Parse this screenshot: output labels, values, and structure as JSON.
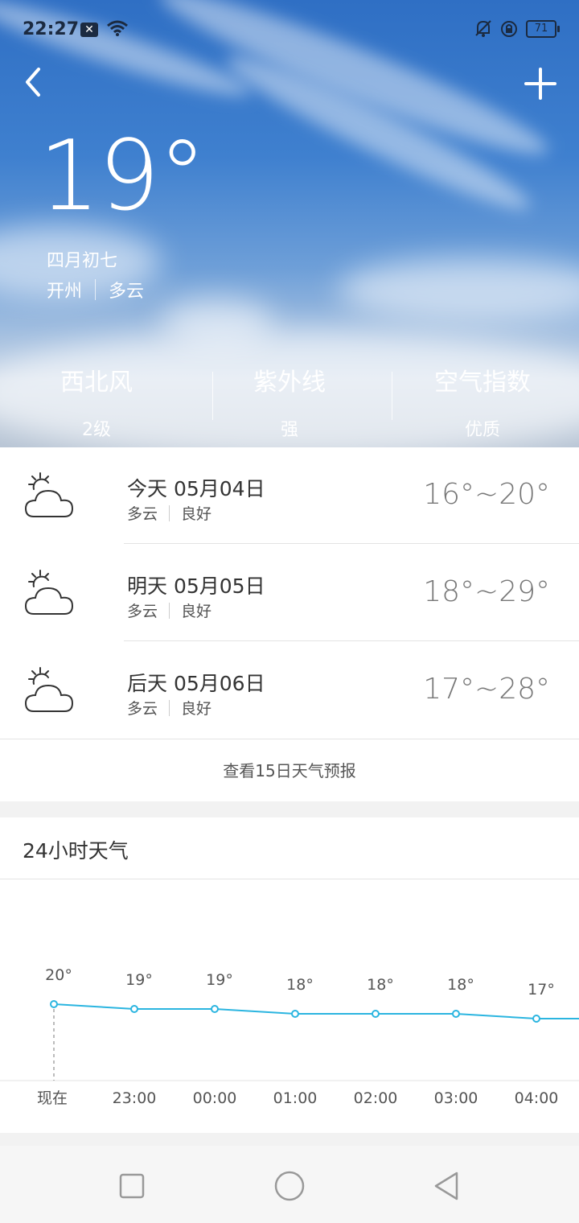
{
  "status_bar": {
    "time": "22:27",
    "battery": "71"
  },
  "current": {
    "temperature": "19°",
    "lunar_date": "四月初七",
    "city": "开州",
    "condition": "多云"
  },
  "metrics": [
    {
      "label": "西北风",
      "value": "2级"
    },
    {
      "label": "紫外线",
      "value": "强"
    },
    {
      "label": "空气指数",
      "value": "优质"
    }
  ],
  "forecast": [
    {
      "date": "今天 05月04日",
      "condition": "多云",
      "air": "良好",
      "range": "16°~20°",
      "icon": "partly-cloudy-icon"
    },
    {
      "date": "明天 05月05日",
      "condition": "多云",
      "air": "良好",
      "range": "18°~29°",
      "icon": "partly-cloudy-icon"
    },
    {
      "date": "后天 05月06日",
      "condition": "多云",
      "air": "良好",
      "range": "17°~28°",
      "icon": "partly-cloudy-icon"
    }
  ],
  "more_link": "查看15日天气预报",
  "hourly": {
    "title": "24小时天气",
    "chart_data": {
      "type": "line",
      "categories": [
        "现在",
        "23:00",
        "00:00",
        "01:00",
        "02:00",
        "03:00",
        "04:00"
      ],
      "series": [
        {
          "values": [
            20,
            19,
            19,
            18,
            18,
            18,
            17
          ]
        }
      ],
      "value_labels": [
        "20°",
        "19°",
        "19°",
        "18°",
        "18°",
        "18°",
        "17°"
      ],
      "line_color": "#2bb5e0"
    }
  },
  "colors": {
    "accent_line": "#2bb5e0"
  }
}
